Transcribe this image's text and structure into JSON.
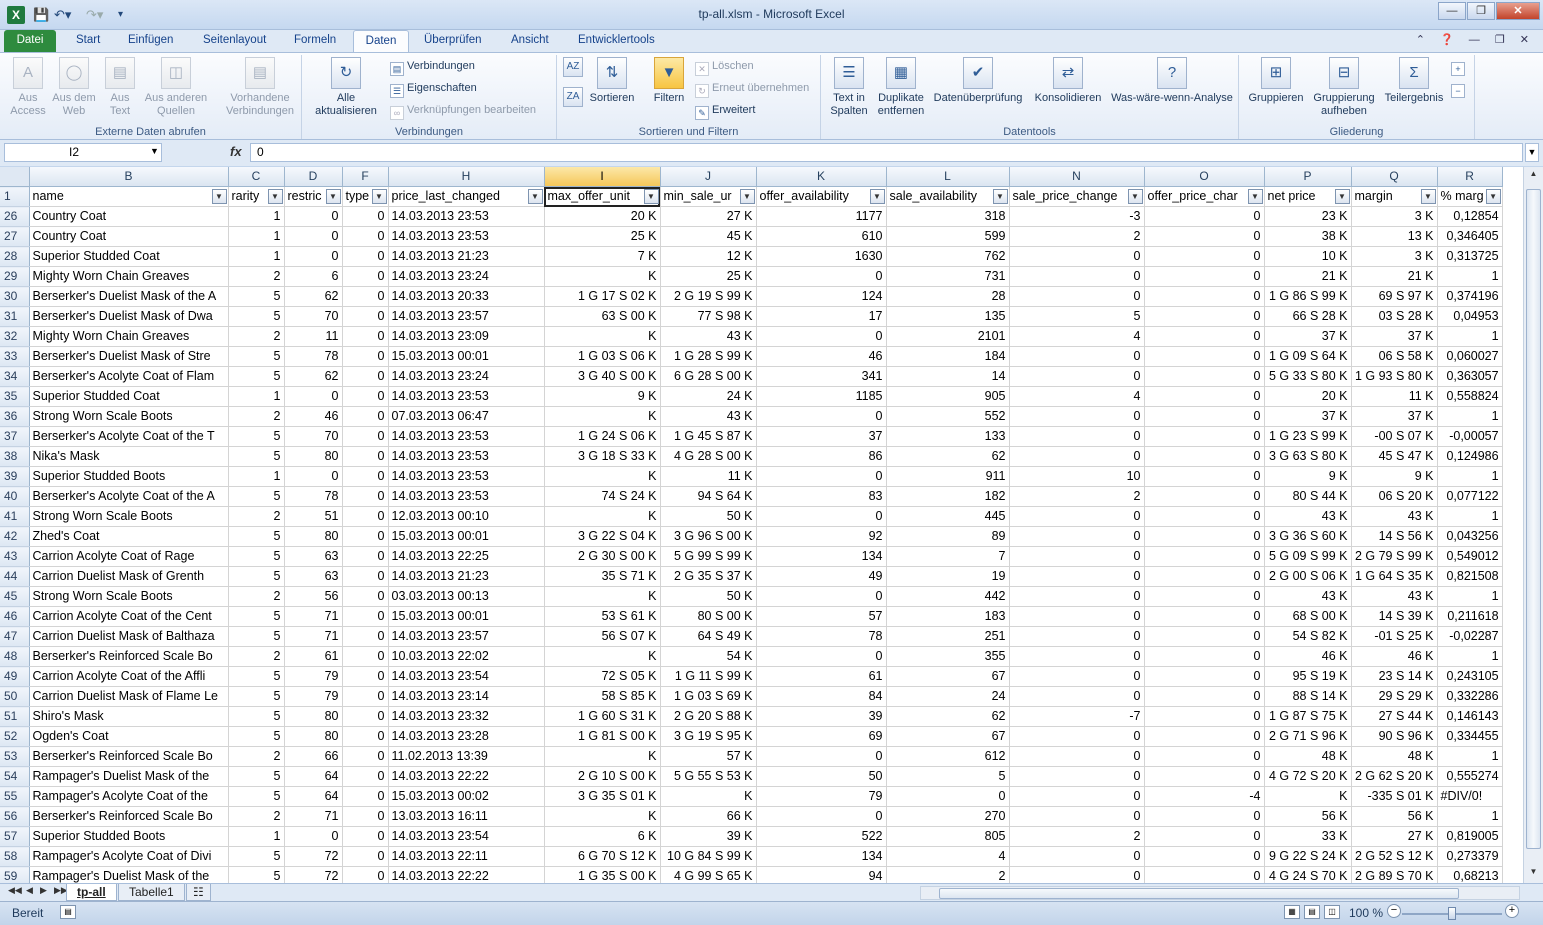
{
  "app": {
    "title": "tp-all.xlsm  -  Microsoft Excel",
    "logo": "X"
  },
  "tabs": [
    "Datei",
    "Start",
    "Einfügen",
    "Seitenlayout",
    "Formeln",
    "Daten",
    "Überprüfen",
    "Ansicht",
    "Entwicklertools"
  ],
  "active_tab": "Daten",
  "ribbon": {
    "external": {
      "label": "Externe Daten abrufen",
      "access": "Aus\nAccess",
      "web": "Aus dem\nWeb",
      "text": "Aus\nText",
      "other": "Aus anderen\nQuellen",
      "existing": "Vorhandene\nVerbindungen"
    },
    "connections": {
      "label": "Verbindungen",
      "refresh": "Alle\naktualisieren",
      "conn": "Verbindungen",
      "props": "Eigenschaften",
      "links": "Verknüpfungen bearbeiten"
    },
    "sort": {
      "label": "Sortieren und Filtern",
      "sort": "Sortieren",
      "filter": "Filtern",
      "clear": "Löschen",
      "reapply": "Erneut übernehmen",
      "advanced": "Erweitert"
    },
    "datatools": {
      "label": "Datentools",
      "text_to_cols": "Text in\nSpalten",
      "dupes": "Duplikate\nentfernen",
      "validation": "Datenüberprüfung",
      "consolidate": "Konsolidieren",
      "whatif": "Was-wäre-wenn-Analyse"
    },
    "outline": {
      "label": "Gliederung",
      "group": "Gruppieren",
      "ungroup": "Gruppierung\naufheben",
      "subtotal": "Teilergebnis"
    }
  },
  "formula": {
    "namebox": "I2",
    "fx": "fx",
    "value": "0"
  },
  "columns": [
    "B",
    "C",
    "D",
    "F",
    "H",
    "I",
    "J",
    "K",
    "L",
    "N",
    "O",
    "P",
    "Q",
    "R"
  ],
  "headers": [
    "name",
    "rarity",
    "restric",
    "type",
    "price_last_changed",
    "max_offer_unit",
    "min_sale_ur",
    "offer_availability",
    "sale_availability",
    "sale_price_change",
    "offer_price_char",
    "net price",
    "margin",
    "% marg"
  ],
  "rows": [
    {
      "n": "1",
      "c": [
        "name",
        "rarity",
        "restric",
        "type",
        "price_last_changed",
        "max_offer_unit",
        "min_sale_ur",
        "offer_availability",
        "sale_availability",
        "sale_price_change",
        "offer_price_char",
        "net price",
        "margin",
        "% marg"
      ]
    },
    {
      "n": "26",
      "c": [
        "Country Coat",
        "1",
        "0",
        "0",
        "14.03.2013 23:53",
        "20 K",
        "27 K",
        "1177",
        "318",
        "-3",
        "0",
        "23 K",
        "3 K",
        "0,12854"
      ]
    },
    {
      "n": "27",
      "c": [
        "Country Coat",
        "1",
        "0",
        "0",
        "14.03.2013 23:53",
        "25 K",
        "45 K",
        "610",
        "599",
        "2",
        "0",
        "38 K",
        "13 K",
        "0,346405"
      ]
    },
    {
      "n": "28",
      "c": [
        "Superior Studded Coat",
        "1",
        "0",
        "0",
        "14.03.2013 21:23",
        "7 K",
        "12 K",
        "1630",
        "762",
        "0",
        "0",
        "10 K",
        "3 K",
        "0,313725"
      ]
    },
    {
      "n": "29",
      "c": [
        "Mighty Worn Chain Greaves",
        "2",
        "6",
        "0",
        "14.03.2013 23:24",
        "K",
        "25 K",
        "0",
        "731",
        "0",
        "0",
        "21 K",
        "21 K",
        "1"
      ]
    },
    {
      "n": "30",
      "c": [
        "Berserker's Duelist Mask of the A",
        "5",
        "62",
        "0",
        "14.03.2013 20:33",
        "1 G 17 S 02 K",
        "2 G 19 S 99 K",
        "124",
        "28",
        "0",
        "0",
        "1 G 86 S 99 K",
        "69 S 97 K",
        "0,374196"
      ]
    },
    {
      "n": "31",
      "c": [
        "Berserker's Duelist Mask of Dwa",
        "5",
        "70",
        "0",
        "14.03.2013 23:57",
        "63 S 00 K",
        "77 S 98 K",
        "17",
        "135",
        "5",
        "0",
        "66 S 28 K",
        "03 S 28 K",
        "0,04953"
      ]
    },
    {
      "n": "32",
      "c": [
        "Mighty Worn Chain Greaves",
        "2",
        "11",
        "0",
        "14.03.2013 23:09",
        "K",
        "43 K",
        "0",
        "2101",
        "4",
        "0",
        "37 K",
        "37 K",
        "1"
      ]
    },
    {
      "n": "33",
      "c": [
        "Berserker's Duelist Mask of Stre",
        "5",
        "78",
        "0",
        "15.03.2013 00:01",
        "1 G 03 S 06 K",
        "1 G 28 S 99 K",
        "46",
        "184",
        "0",
        "0",
        "1 G 09 S 64 K",
        "06 S 58 K",
        "0,060027"
      ]
    },
    {
      "n": "34",
      "c": [
        "Berserker's Acolyte Coat of Flam",
        "5",
        "62",
        "0",
        "14.03.2013 23:24",
        "3 G 40 S 00 K",
        "6 G 28 S 00 K",
        "341",
        "14",
        "0",
        "0",
        "5 G 33 S 80 K",
        "1 G 93 S 80 K",
        "0,363057"
      ]
    },
    {
      "n": "35",
      "c": [
        "Superior Studded Coat",
        "1",
        "0",
        "0",
        "14.03.2013 23:53",
        "9 K",
        "24 K",
        "1185",
        "905",
        "4",
        "0",
        "20 K",
        "11 K",
        "0,558824"
      ]
    },
    {
      "n": "36",
      "c": [
        "Strong Worn Scale Boots",
        "2",
        "46",
        "0",
        "07.03.2013 06:47",
        "K",
        "43 K",
        "0",
        "552",
        "0",
        "0",
        "37 K",
        "37 K",
        "1"
      ]
    },
    {
      "n": "37",
      "c": [
        "Berserker's Acolyte Coat of the T",
        "5",
        "70",
        "0",
        "14.03.2013 23:53",
        "1 G 24 S 06 K",
        "1 G 45 S 87 K",
        "37",
        "133",
        "0",
        "0",
        "1 G 23 S 99 K",
        "-00 S 07 K",
        "-0,00057"
      ]
    },
    {
      "n": "38",
      "c": [
        "Nika's Mask",
        "5",
        "80",
        "0",
        "14.03.2013 23:53",
        "3 G 18 S 33 K",
        "4 G 28 S 00 K",
        "86",
        "62",
        "0",
        "0",
        "3 G 63 S 80 K",
        "45 S 47 K",
        "0,124986"
      ]
    },
    {
      "n": "39",
      "c": [
        "Superior Studded Boots",
        "1",
        "0",
        "0",
        "14.03.2013 23:53",
        "K",
        "11 K",
        "0",
        "911",
        "10",
        "0",
        "9 K",
        "9 K",
        "1"
      ]
    },
    {
      "n": "40",
      "c": [
        "Berserker's Acolyte Coat of the A",
        "5",
        "78",
        "0",
        "14.03.2013 23:53",
        "74 S 24 K",
        "94 S 64 K",
        "83",
        "182",
        "2",
        "0",
        "80 S 44 K",
        "06 S 20 K",
        "0,077122"
      ]
    },
    {
      "n": "41",
      "c": [
        "Strong Worn Scale Boots",
        "2",
        "51",
        "0",
        "12.03.2013 00:10",
        "K",
        "50 K",
        "0",
        "445",
        "0",
        "0",
        "43 K",
        "43 K",
        "1"
      ]
    },
    {
      "n": "42",
      "c": [
        "Zhed's Coat",
        "5",
        "80",
        "0",
        "15.03.2013 00:01",
        "3 G 22 S 04 K",
        "3 G 96 S 00 K",
        "92",
        "89",
        "0",
        "0",
        "3 G 36 S 60 K",
        "14 S 56 K",
        "0,043256"
      ]
    },
    {
      "n": "43",
      "c": [
        "Carrion Acolyte Coat of Rage",
        "5",
        "63",
        "0",
        "14.03.2013 22:25",
        "2 G 30 S 00 K",
        "5 G 99 S 99 K",
        "134",
        "7",
        "0",
        "0",
        "5 G 09 S 99 K",
        "2 G 79 S 99 K",
        "0,549012"
      ]
    },
    {
      "n": "44",
      "c": [
        "Carrion Duelist Mask of Grenth",
        "5",
        "63",
        "0",
        "14.03.2013 21:23",
        "35 S 71 K",
        "2 G 35 S 37 K",
        "49",
        "19",
        "0",
        "0",
        "2 G 00 S 06 K",
        "1 G 64 S 35 K",
        "0,821508"
      ]
    },
    {
      "n": "45",
      "c": [
        "Strong Worn Scale Boots",
        "2",
        "56",
        "0",
        "03.03.2013 00:13",
        "K",
        "50 K",
        "0",
        "442",
        "0",
        "0",
        "43 K",
        "43 K",
        "1"
      ]
    },
    {
      "n": "46",
      "c": [
        "Carrion Acolyte Coat of the Cent",
        "5",
        "71",
        "0",
        "15.03.2013 00:01",
        "53 S 61 K",
        "80 S 00 K",
        "57",
        "183",
        "0",
        "0",
        "68 S 00 K",
        "14 S 39 K",
        "0,211618"
      ]
    },
    {
      "n": "47",
      "c": [
        "Carrion Duelist Mask of Balthaza",
        "5",
        "71",
        "0",
        "14.03.2013 23:57",
        "56 S 07 K",
        "64 S 49 K",
        "78",
        "251",
        "0",
        "0",
        "54 S 82 K",
        "-01 S 25 K",
        "-0,02287"
      ]
    },
    {
      "n": "48",
      "c": [
        "Berserker's Reinforced Scale Bo",
        "2",
        "61",
        "0",
        "10.03.2013 22:02",
        "K",
        "54 K",
        "0",
        "355",
        "0",
        "0",
        "46 K",
        "46 K",
        "1"
      ]
    },
    {
      "n": "49",
      "c": [
        "Carrion Acolyte Coat of the Affli",
        "5",
        "79",
        "0",
        "14.03.2013 23:54",
        "72 S 05 K",
        "1 G 11 S 99 K",
        "61",
        "67",
        "0",
        "0",
        "95 S 19 K",
        "23 S 14 K",
        "0,243105"
      ]
    },
    {
      "n": "50",
      "c": [
        "Carrion Duelist Mask of Flame Le",
        "5",
        "79",
        "0",
        "14.03.2013 23:14",
        "58 S 85 K",
        "1 G 03 S 69 K",
        "84",
        "24",
        "0",
        "0",
        "88 S 14 K",
        "29 S 29 K",
        "0,332286"
      ]
    },
    {
      "n": "51",
      "c": [
        "Shiro's Mask",
        "5",
        "80",
        "0",
        "14.03.2013 23:32",
        "1 G 60 S 31 K",
        "2 G 20 S 88 K",
        "39",
        "62",
        "-7",
        "0",
        "1 G 87 S 75 K",
        "27 S 44 K",
        "0,146143"
      ]
    },
    {
      "n": "52",
      "c": [
        "Ogden's Coat",
        "5",
        "80",
        "0",
        "14.03.2013 23:28",
        "1 G 81 S 00 K",
        "3 G 19 S 95 K",
        "69",
        "67",
        "0",
        "0",
        "2 G 71 S 96 K",
        "90 S 96 K",
        "0,334455"
      ]
    },
    {
      "n": "53",
      "c": [
        "Berserker's Reinforced Scale Bo",
        "2",
        "66",
        "0",
        "11.02.2013 13:39",
        "K",
        "57 K",
        "0",
        "612",
        "0",
        "0",
        "48 K",
        "48 K",
        "1"
      ]
    },
    {
      "n": "54",
      "c": [
        "Rampager's Duelist Mask of the",
        "5",
        "64",
        "0",
        "14.03.2013 22:22",
        "2 G 10 S 00 K",
        "5 G 55 S 53 K",
        "50",
        "5",
        "0",
        "0",
        "4 G 72 S 20 K",
        "2 G 62 S 20 K",
        "0,555274"
      ]
    },
    {
      "n": "55",
      "c": [
        "Rampager's Acolyte Coat of the",
        "5",
        "64",
        "0",
        "15.03.2013 00:02",
        "3 G 35 S 01 K",
        "K",
        "79",
        "0",
        "0",
        "-4",
        "K",
        "-335 S 01 K",
        "#DIV/0!"
      ]
    },
    {
      "n": "56",
      "c": [
        "Berserker's Reinforced Scale Bo",
        "2",
        "71",
        "0",
        "13.03.2013 16:11",
        "K",
        "66 K",
        "0",
        "270",
        "0",
        "0",
        "56 K",
        "56 K",
        "1"
      ]
    },
    {
      "n": "57",
      "c": [
        "Superior Studded Boots",
        "1",
        "0",
        "0",
        "14.03.2013 23:54",
        "6 K",
        "39 K",
        "522",
        "805",
        "2",
        "0",
        "33 K",
        "27 K",
        "0,819005"
      ]
    },
    {
      "n": "58",
      "c": [
        "Rampager's Acolyte Coat of Divi",
        "5",
        "72",
        "0",
        "14.03.2013 22:11",
        "6 G 70 S 12 K",
        "10 G 84 S 99 K",
        "134",
        "4",
        "0",
        "0",
        "9 G 22 S 24 K",
        "2 G 52 S 12 K",
        "0,273379"
      ]
    },
    {
      "n": "59",
      "c": [
        "Rampager's Duelist Mask of the",
        "5",
        "72",
        "0",
        "14.03.2013 22:22",
        "1 G 35 S 00 K",
        "4 G 99 S 65 K",
        "94",
        "2",
        "0",
        "0",
        "4 G 24 S 70 K",
        "2 G 89 S 70 K",
        "0,68213"
      ]
    }
  ],
  "sheets": [
    "tp-all",
    "Tabelle1"
  ],
  "active_sheet": "tp-all",
  "status": {
    "text": "Bereit",
    "zoom": "100 %",
    "zoom_level_percent": 100
  }
}
